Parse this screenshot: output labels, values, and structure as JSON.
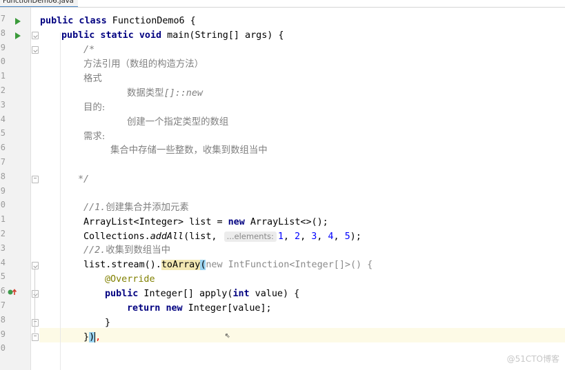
{
  "tab": {
    "filename": "FunctionDemo6.java"
  },
  "line_numbers": [
    "7",
    "8",
    "9",
    "0",
    "1",
    "2",
    "3",
    "4",
    "5",
    "6",
    "7",
    "8",
    "9",
    "0",
    "1",
    "2",
    "3",
    "4",
    "5",
    "6",
    "7",
    "8",
    "9",
    "0"
  ],
  "code": {
    "l1_kw": "public class",
    "l1_rest": " FunctionDemo6 {",
    "l2_kw": "public static void",
    "l2_rest": " main(String[] args) {",
    "l3": "/*",
    "l4": "方法引用（数组的构造方法）",
    "l5": "格式",
    "l6_cn": "数据类型",
    "l6_rest": "[]::new",
    "l7": "目的:",
    "l8": "创建一个指定类型的数组",
    "l9": "需求:",
    "l10": "集合中存储一些整数，收集到数组当中",
    "l12": "*/",
    "l14_a": "//1.",
    "l14_b": "创建集合并添加元素",
    "l15_a": "ArrayList<Integer> list = ",
    "l15_kw": "new",
    "l15_b": " ArrayList<>();",
    "l16_a": "Collections.",
    "l16_m": "addAll",
    "l16_b": "(list, ",
    "l16_hint": "...elements:",
    "l16_n1": "1",
    "l16_n2": "2",
    "l16_n3": "3",
    "l16_n4": "4",
    "l16_n5": "5",
    "l16_end": ");",
    "l17_a": "//2.",
    "l17_b": "收集到数组当中",
    "l18_a": "list.stream().",
    "l18_m": "toArray",
    "l18_p": "(",
    "l18_new": "new",
    "l18_b": " IntFunction<Integer[]>() {",
    "l19": "@Override",
    "l20_kw": "public",
    "l20_a": " Integer[] apply(",
    "l20_kw2": "int",
    "l20_b": " value) {",
    "l21_kw": "return",
    "l21_kw2": "new",
    "l21_b": " Integer[value];",
    "l22": "}",
    "l23_a": "}",
    "l23_p": ")",
    "watermark": "@51CTO博客"
  }
}
